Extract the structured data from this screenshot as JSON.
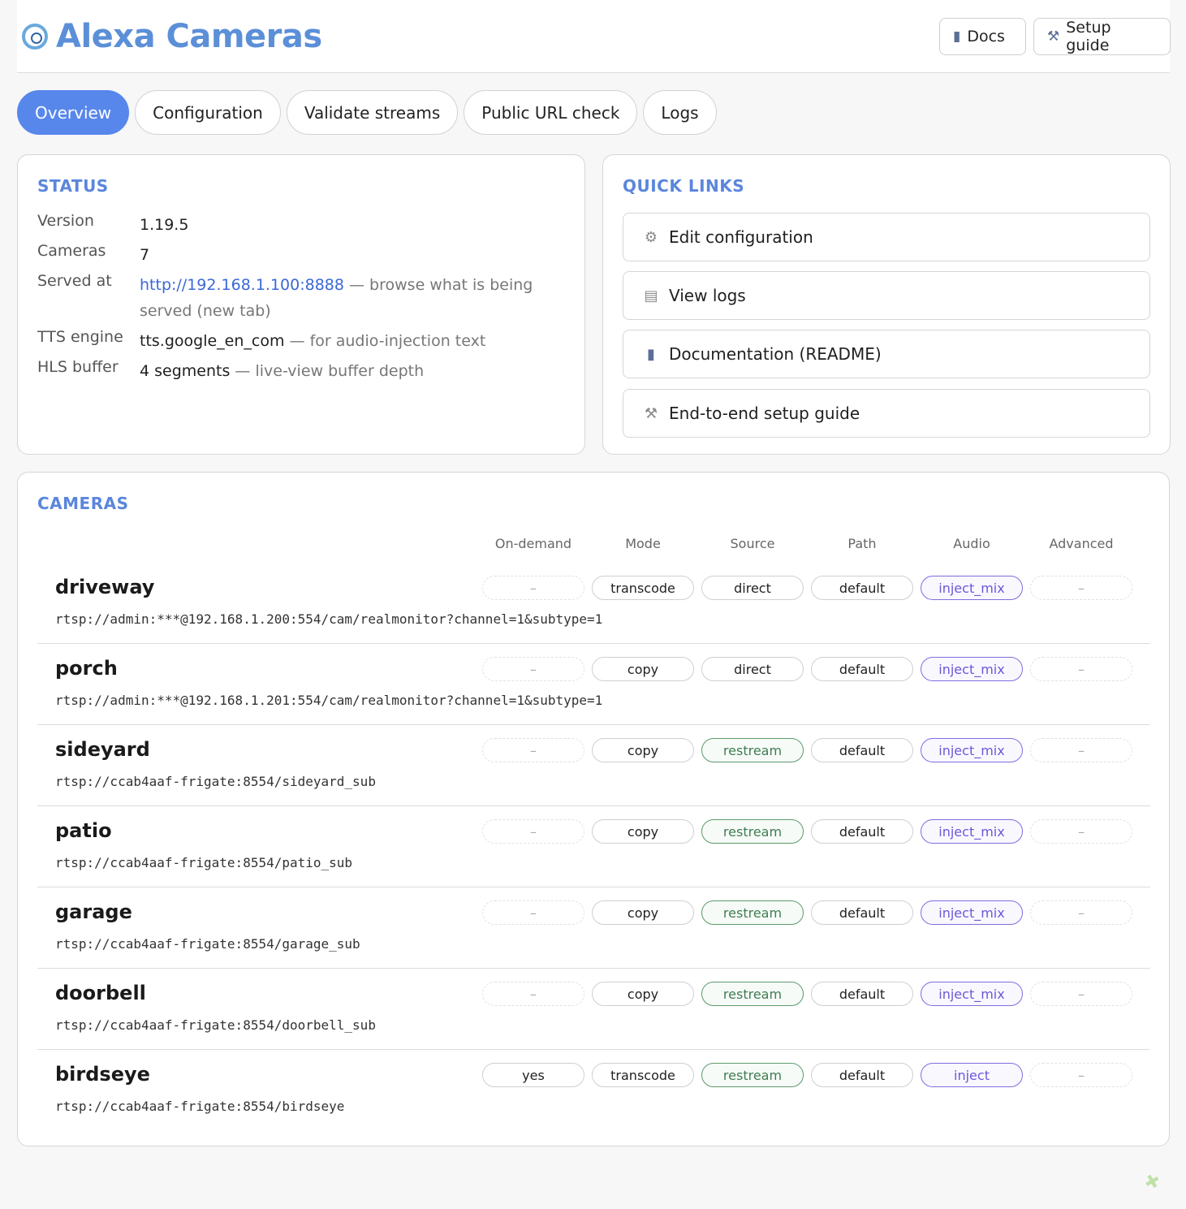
{
  "header": {
    "title": "Alexa Cameras",
    "docs_label": "Docs",
    "setup_label": "Setup guide"
  },
  "tabs": [
    {
      "label": "Overview",
      "active": true
    },
    {
      "label": "Configuration"
    },
    {
      "label": "Validate streams"
    },
    {
      "label": "Public URL check"
    },
    {
      "label": "Logs"
    }
  ],
  "status": {
    "title": "STATUS",
    "version_label": "Version",
    "version": "1.19.5",
    "cameras_label": "Cameras",
    "cameras": "7",
    "served_label": "Served at",
    "served_url": "http://192.168.1.100:8888",
    "served_note": "— browse what is being served (new tab)",
    "tts_label": "TTS engine",
    "tts": "tts.google_en_com",
    "tts_note": "— for audio-injection text",
    "hls_label": "HLS buffer",
    "hls": "4 segments",
    "hls_note": "— live-view buffer depth"
  },
  "quick_links": {
    "title": "QUICK LINKS",
    "items": [
      {
        "label": "Edit configuration",
        "icon": "gear-icon"
      },
      {
        "label": "View logs",
        "icon": "document-icon"
      },
      {
        "label": "Documentation (README)",
        "icon": "book-icon"
      },
      {
        "label": "End-to-end setup guide",
        "icon": "tools-icon"
      }
    ]
  },
  "cameras": {
    "title": "CAMERAS",
    "columns": [
      "On-demand",
      "Mode",
      "Source",
      "Path",
      "Audio",
      "Advanced"
    ],
    "rows": [
      {
        "name": "driveway",
        "url": "rtsp://admin:***@192.168.1.200:554/cam/realmonitor?channel=1&subtype=1",
        "cells": [
          "–",
          "transcode",
          "direct",
          "default",
          "inject_mix",
          "–"
        ]
      },
      {
        "name": "porch",
        "url": "rtsp://admin:***@192.168.1.201:554/cam/realmonitor?channel=1&subtype=1",
        "cells": [
          "–",
          "copy",
          "direct",
          "default",
          "inject_mix",
          "–"
        ]
      },
      {
        "name": "sideyard",
        "url": "rtsp://ccab4aaf-frigate:8554/sideyard_sub",
        "cells": [
          "–",
          "copy",
          "restream",
          "default",
          "inject_mix",
          "–"
        ]
      },
      {
        "name": "patio",
        "url": "rtsp://ccab4aaf-frigate:8554/patio_sub",
        "cells": [
          "–",
          "copy",
          "restream",
          "default",
          "inject_mix",
          "–"
        ]
      },
      {
        "name": "garage",
        "url": "rtsp://ccab4aaf-frigate:8554/garage_sub",
        "cells": [
          "–",
          "copy",
          "restream",
          "default",
          "inject_mix",
          "–"
        ]
      },
      {
        "name": "doorbell",
        "url": "rtsp://ccab4aaf-frigate:8554/doorbell_sub",
        "cells": [
          "–",
          "copy",
          "restream",
          "default",
          "inject_mix",
          "–"
        ]
      },
      {
        "name": "birdseye",
        "url": "rtsp://ccab4aaf-frigate:8554/birdseye",
        "cells": [
          "yes",
          "transcode",
          "restream",
          "default",
          "inject",
          "–"
        ]
      }
    ]
  }
}
